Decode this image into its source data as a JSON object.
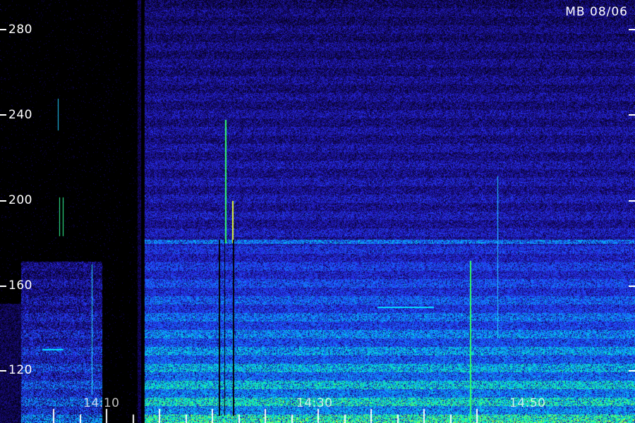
{
  "header": {
    "station_label": "MB 08/06"
  },
  "y_axis": {
    "labels": [
      "280",
      "240",
      "200",
      "160",
      "120"
    ]
  },
  "x_axis": {
    "labels": [
      "14:10",
      "14:30",
      "14:50"
    ]
  },
  "colors": {
    "background": "#000000",
    "low": "#1a0a8c",
    "mid": "#1a4bff",
    "high": "#00e6e6",
    "peak": "#33ff33",
    "tick": "#ffffff"
  }
}
